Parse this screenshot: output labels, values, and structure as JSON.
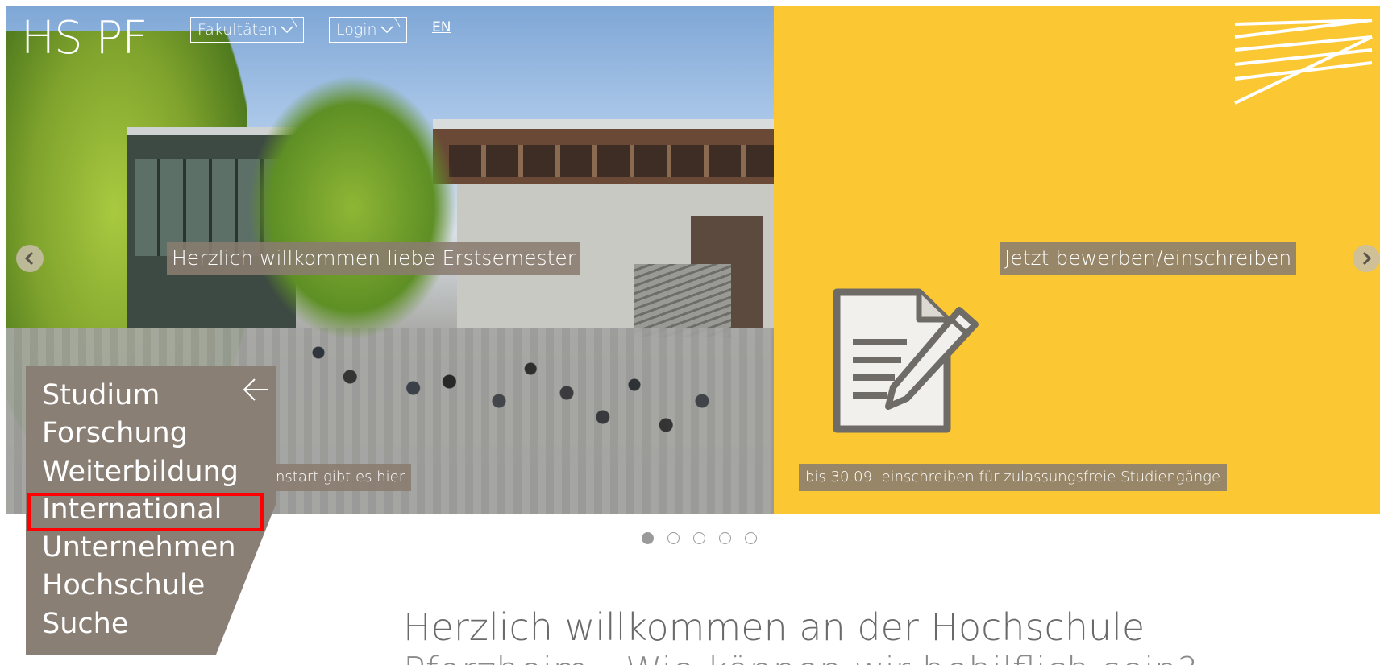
{
  "header": {
    "logo": "HS PF",
    "faculties_label": "Fakultäten",
    "login_label": "Login",
    "language_label": "EN"
  },
  "slider": {
    "slides": [
      {
        "title": "Herzlich willkommen liebe Erstsemester",
        "subtitle": "nstart gibt es hier"
      },
      {
        "title": "Jetzt bewerben/einschreiben",
        "subtitle": "bis 30.09. einschreiben für zulassungsfreie Studiengänge"
      }
    ],
    "dots_count": 5,
    "active_dot": 1
  },
  "menu": {
    "items": [
      "Studium",
      "Forschung",
      "Weiterbildung",
      "International",
      "Unternehmen",
      "Hochschule",
      "Suche"
    ],
    "highlighted": "International"
  },
  "main": {
    "welcome_line1": "Herzlich willkommen an der Hochschule",
    "welcome_line2": "Pforzheim - Wie können wir behilflich sein?"
  },
  "colors": {
    "accent_yellow": "#fbc834",
    "menu_bg": "#8a7f75",
    "caption_bg": "#8a7c70",
    "highlight": "#ff0000"
  },
  "icons": {
    "prev": "chevron-left-icon",
    "next": "chevron-right-icon",
    "close_menu": "arrow-left-icon",
    "document": "document-edit-icon",
    "brand": "stripes-logo-icon"
  }
}
